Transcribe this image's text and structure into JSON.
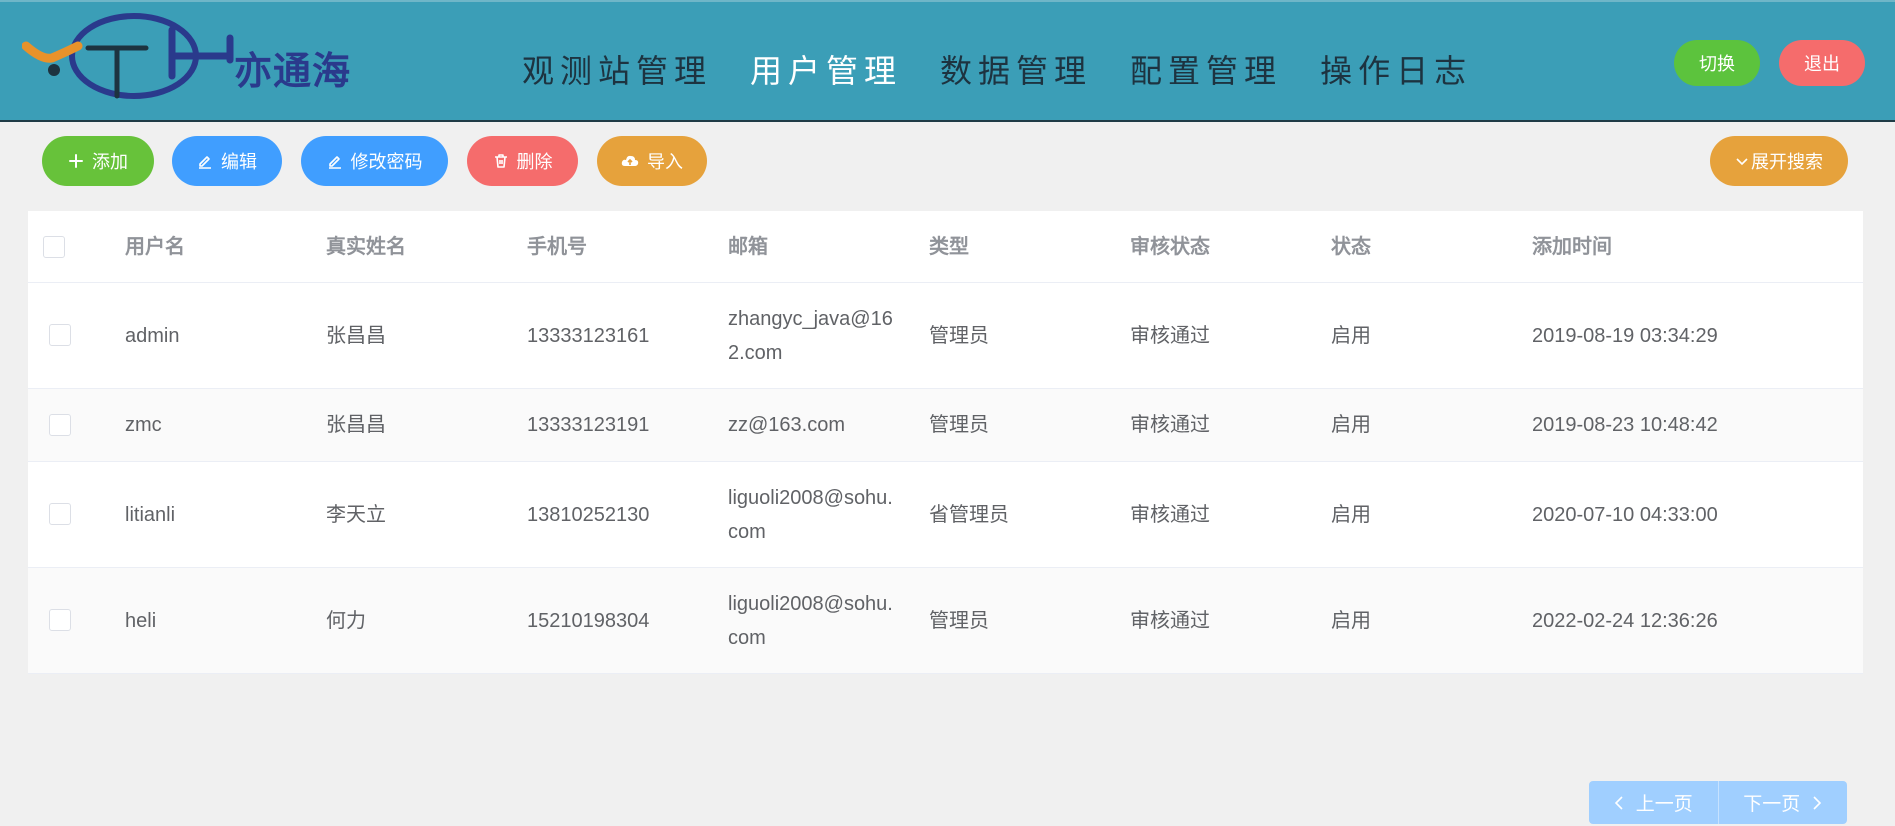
{
  "header": {
    "logo_text": "亦通海",
    "nav": [
      {
        "label": "观测站管理",
        "active": false
      },
      {
        "label": "用户管理",
        "active": true
      },
      {
        "label": "数据管理",
        "active": false
      },
      {
        "label": "配置管理",
        "active": false
      },
      {
        "label": "操作日志",
        "active": false
      }
    ],
    "switch_label": "切换",
    "logout_label": "退出"
  },
  "toolbar": {
    "add_label": "添加",
    "edit_label": "编辑",
    "change_password_label": "修改密码",
    "delete_label": "删除",
    "import_label": "导入",
    "expand_search_label": "展开搜索"
  },
  "table": {
    "columns": [
      "用户名",
      "真实姓名",
      "手机号",
      "邮箱",
      "类型",
      "审核状态",
      "状态",
      "添加时间"
    ],
    "rows": [
      {
        "username": "admin",
        "real_name": "张昌昌",
        "phone": "13333123161",
        "email": "zhangyc_java@162.com",
        "type": "管理员",
        "audit": "审核通过",
        "status": "启用",
        "added": "2019-08-19 03:34:29"
      },
      {
        "username": "zmc",
        "real_name": "张昌昌",
        "phone": "13333123191",
        "email": "zz@163.com",
        "type": "管理员",
        "audit": "审核通过",
        "status": "启用",
        "added": "2019-08-23 10:48:42"
      },
      {
        "username": "litianli",
        "real_name": "李天立",
        "phone": "13810252130",
        "email": "liguoli2008@sohu.com",
        "type": "省管理员",
        "audit": "审核通过",
        "status": "启用",
        "added": "2020-07-10 04:33:00"
      },
      {
        "username": "heli",
        "real_name": "何力",
        "phone": "15210198304",
        "email": "liguoli2008@sohu.com",
        "type": "管理员",
        "audit": "审核通过",
        "status": "启用",
        "added": "2022-02-24 12:36:26"
      }
    ]
  },
  "pagination": {
    "prev_label": "上一页",
    "next_label": "下一页"
  },
  "colors": {
    "header_bg": "#3b9eb7",
    "success": "#67c23a",
    "primary": "#409eff",
    "danger": "#f56c6c",
    "warning": "#e6a23c"
  },
  "icons": {
    "add": "plus-icon",
    "edit": "pencil-icon",
    "password": "pencil-icon",
    "delete": "trash-icon",
    "import": "cloud-upload-icon",
    "expand": "chevron-down-icon",
    "prev": "chevron-left-icon",
    "next": "chevron-right-icon"
  }
}
